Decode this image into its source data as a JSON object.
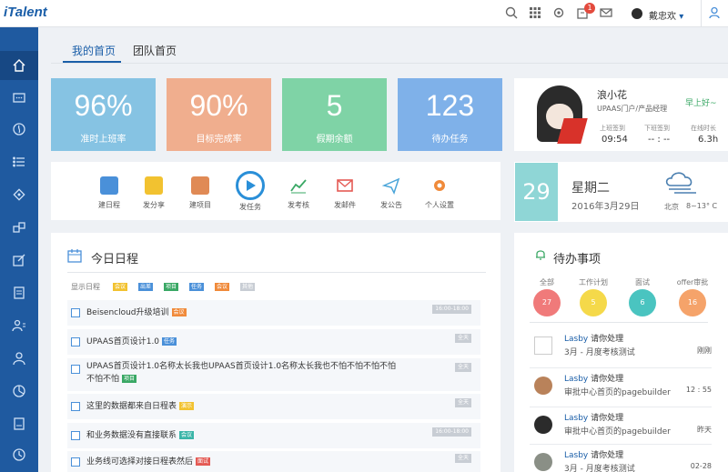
{
  "app": {
    "logo": "iTalent"
  },
  "header": {
    "notification_count": "1",
    "username": "戴忠欢",
    "user_caret": "▾"
  },
  "tabs": [
    {
      "label": "我的首页"
    },
    {
      "label": "团队首页"
    }
  ],
  "stats": [
    {
      "value": "96%",
      "label": "准时上班率",
      "color": "#86c3e3"
    },
    {
      "value": "90%",
      "label": "目标完成率",
      "color": "#f0ae8e"
    },
    {
      "value": "5",
      "label": "假期余额",
      "color": "#7fd3a6"
    },
    {
      "value": "123",
      "label": "待办任务",
      "color": "#7fb1e9"
    }
  ],
  "profile": {
    "name": "浪小花",
    "title": "UPAAS门户/产品经理",
    "greeting": "早上好~",
    "checkin_label": "上班签到",
    "checkin_value": "09:54",
    "checkout_label": "下班签到",
    "checkout_value": "-- : --",
    "online_label": "在线时长",
    "online_value": "6.3h"
  },
  "quick_actions": [
    {
      "label": "建日程",
      "color": "#4a90d9"
    },
    {
      "label": "发分享",
      "color": "#f2c230"
    },
    {
      "label": "建项目",
      "color": "#e08a55"
    },
    {
      "label": "发任务",
      "color": "#2a8fd8"
    },
    {
      "label": "发考核",
      "color": "#3aa865"
    },
    {
      "label": "发邮件",
      "color": "#e45a54"
    },
    {
      "label": "发公告",
      "color": "#4aa5d9"
    },
    {
      "label": "个人设置",
      "color": "#f08a3a"
    }
  ],
  "date_card": {
    "day": "29",
    "weekday": "星期二",
    "date": "2016年3月29日",
    "city": "北京",
    "temperature": "8~13° C"
  },
  "schedule": {
    "title": "今日日程",
    "legend_label": "显示日程",
    "legend": [
      {
        "label": "会议",
        "color": "#f2c230"
      },
      {
        "label": "出差",
        "color": "#4a90d9"
      },
      {
        "label": "项目",
        "color": "#3aa865"
      },
      {
        "label": "任务",
        "color": "#4a90d9"
      },
      {
        "label": "会议",
        "color": "#f08a3a"
      },
      {
        "label": "其他",
        "color": "#c8cdd4"
      }
    ],
    "items": [
      {
        "text": "Beisencloud升级培训",
        "tag": "会议",
        "tag_color": "#f08a3a",
        "time": "16:00-18:00"
      },
      {
        "text": "UPAAS首页设计1.0",
        "tag": "任务",
        "tag_color": "#4a90d9",
        "time": "全天"
      },
      {
        "text": "UPAAS首页设计1.0名称太长我也UPAAS首页设计1.0名称太长我也不怕不怕不怕不怕",
        "text2": "不怕不怕",
        "tag": "项目",
        "tag_color": "#3aa865",
        "time": "全天"
      },
      {
        "text": "这里的数据都来自日程表",
        "tag": "演示",
        "tag_color": "#f2c230",
        "time": "全天"
      },
      {
        "text": "和业务数据没有直接联系",
        "tag": "会议",
        "tag_color": "#3ab5a8",
        "time": "16:00-18:00"
      },
      {
        "text": "业务线可选择对接日程表然后",
        "tag": "面试",
        "tag_color": "#e45a54",
        "time": "全天"
      }
    ]
  },
  "todo": {
    "title": "待办事项",
    "categories": [
      {
        "label": "全部",
        "count": "27",
        "color": "#f07a7a"
      },
      {
        "label": "工作计划",
        "count": "5",
        "color": "#f5d94a"
      },
      {
        "label": "面试",
        "count": "6",
        "color": "#4ac4c0"
      },
      {
        "label": "offer审批",
        "count": "16",
        "color": "#f5a36a"
      }
    ],
    "items": [
      {
        "who": "Lasby",
        "action": "请你处理",
        "desc": "3月 - 月度考核测试",
        "time": "刚刚",
        "avatar": "#ffffff"
      },
      {
        "who": "Lasby",
        "action": "请你处理",
        "desc": "审批中心首页的pagebuilder",
        "time": "12 : 55",
        "avatar": "#b9825a"
      },
      {
        "who": "Lasby",
        "action": "请你处理",
        "desc": "审批中心首页的pagebuilder",
        "time": "昨天",
        "avatar": "#2b2b2b"
      },
      {
        "who": "Lasby",
        "action": "请你处理",
        "desc": "3月 - 月度考核测试",
        "time": "02-28",
        "avatar": "#8a8f86"
      }
    ]
  }
}
